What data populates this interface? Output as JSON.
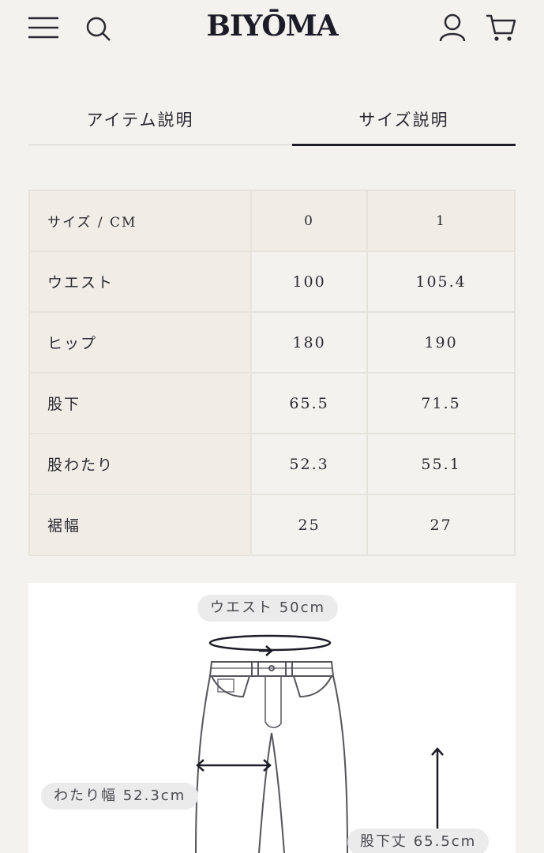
{
  "header": {
    "brand": "BIYŌMA",
    "icons": [
      "menu-icon",
      "search-icon",
      "user-icon",
      "cart-icon"
    ]
  },
  "tabs": [
    {
      "label": "アイテム説明",
      "active": false
    },
    {
      "label": "サイズ説明",
      "active": true
    }
  ],
  "size_table": {
    "header": [
      "サイズ / CM",
      "0",
      "1"
    ],
    "rows": [
      {
        "label": "ウエスト",
        "values": [
          "100",
          "105.4"
        ]
      },
      {
        "label": "ヒップ",
        "values": [
          "180",
          "190"
        ]
      },
      {
        "label": "股下",
        "values": [
          "65.5",
          "71.5"
        ]
      },
      {
        "label": "股わたり",
        "values": [
          "52.3",
          "55.1"
        ]
      },
      {
        "label": "裾幅",
        "values": [
          "25",
          "27"
        ]
      }
    ]
  },
  "diagram": {
    "waist_label": "ウエスト 50cm",
    "thigh_label": "わたり幅 52.3cm",
    "inseam_label": "股下丈 65.5cm"
  },
  "colors": {
    "background": "#f4f2ee",
    "label_cell": "#f1ede6",
    "text": "#2a2a33",
    "active_underline": "#1c1c28"
  }
}
